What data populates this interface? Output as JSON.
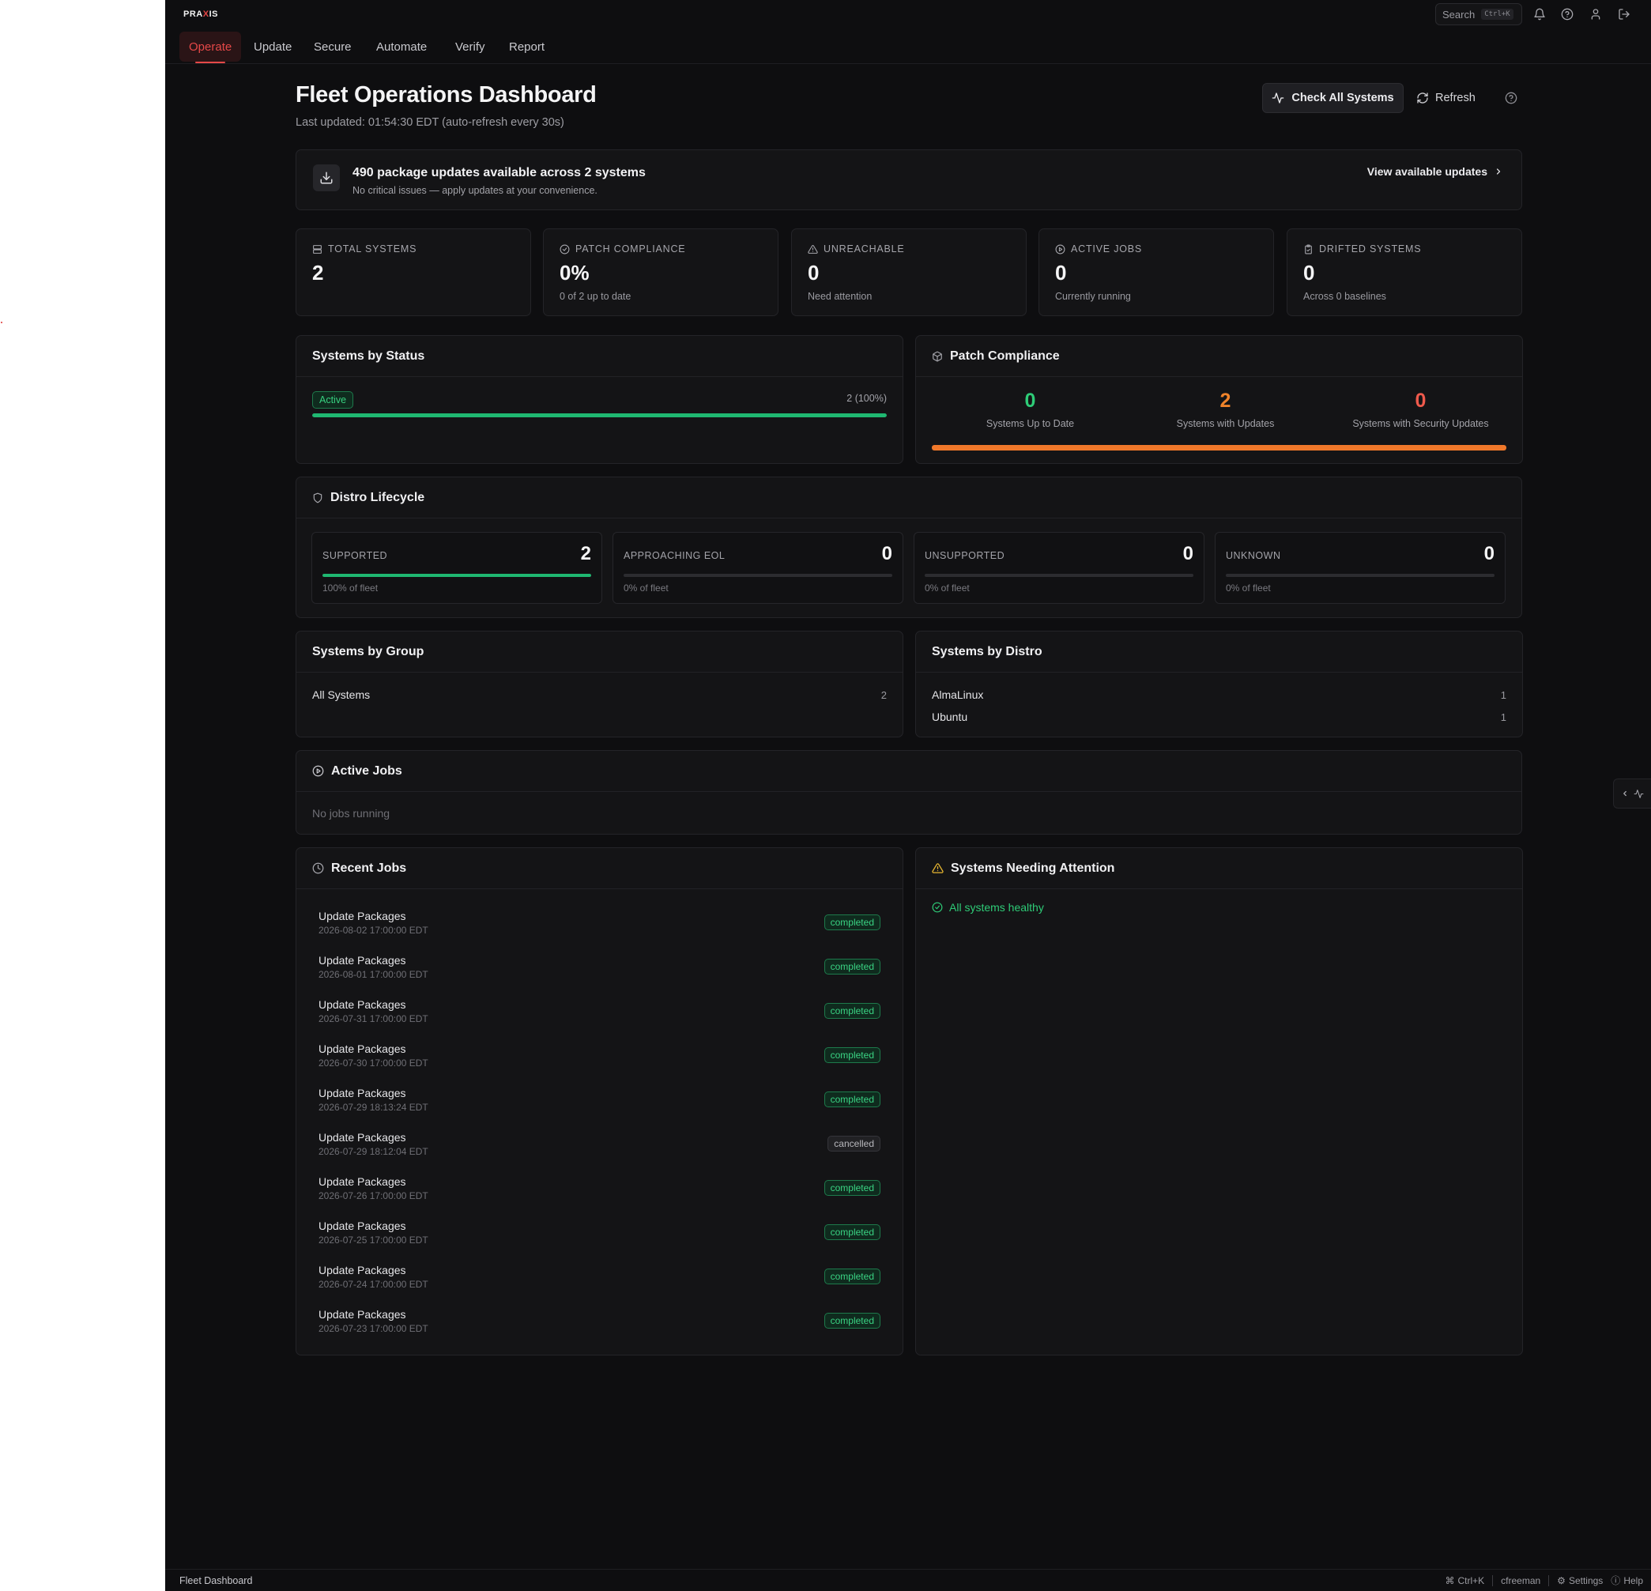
{
  "app": {
    "logo": "PRAXIS"
  },
  "topbar": {
    "search_label": "Search",
    "search_shortcut": "Ctrl+K"
  },
  "nav": {
    "tabs": [
      {
        "label": "Operate",
        "active": true
      },
      {
        "label": "Update"
      },
      {
        "label": "Secure"
      },
      {
        "label": "Automate"
      },
      {
        "label": "Verify"
      },
      {
        "label": "Report"
      }
    ]
  },
  "header": {
    "title": "Fleet Operations Dashboard",
    "subtitle": "Last updated: 01:54:30 EDT (auto-refresh every 30s)",
    "check_label": "Check All Systems",
    "refresh_label": "Refresh"
  },
  "banner": {
    "title": "490 package updates available across 2 systems",
    "subtitle": "No critical issues — apply updates at your convenience.",
    "link": "View available updates"
  },
  "stats": [
    {
      "label": "TOTAL SYSTEMS",
      "value": "2",
      "sub": "",
      "icon": "server-icon"
    },
    {
      "label": "PATCH COMPLIANCE",
      "value": "0%",
      "sub": "0 of 2 up to date",
      "icon": "check-circle-icon"
    },
    {
      "label": "UNREACHABLE",
      "value": "0",
      "sub": "Need attention",
      "icon": "warning-icon"
    },
    {
      "label": "ACTIVE JOBS",
      "value": "0",
      "sub": "Currently running",
      "icon": "play-circle-icon"
    },
    {
      "label": "DRIFTED SYSTEMS",
      "value": "0",
      "sub": "Across 0 baselines",
      "icon": "clipboard-icon"
    }
  ],
  "status_card": {
    "title": "Systems by Status",
    "badge": "Active",
    "count": "2 (100%)",
    "fill": 1.0,
    "color": "#1fb871"
  },
  "patch_card": {
    "title": "Patch Compliance",
    "cols": [
      {
        "value": "0",
        "label": "Systems Up to Date",
        "color": "#2ecc77"
      },
      {
        "value": "2",
        "label": "Systems with Updates",
        "color": "#f0832a"
      },
      {
        "value": "0",
        "label": "Systems with Security Updates",
        "color": "#ef5a4c"
      }
    ],
    "bar_color": "#f0782a",
    "fill": 1.0
  },
  "lifecycle": {
    "title": "Distro Lifecycle",
    "items": [
      {
        "label": "SUPPORTED",
        "value": "2",
        "pct": "100% of fleet",
        "fill": 1.0
      },
      {
        "label": "APPROACHING EOL",
        "value": "0",
        "pct": "0% of fleet",
        "fill": 0
      },
      {
        "label": "UNSUPPORTED",
        "value": "0",
        "pct": "0% of fleet",
        "fill": 0
      },
      {
        "label": "UNKNOWN",
        "value": "0",
        "pct": "0% of fleet",
        "fill": 0
      }
    ]
  },
  "groups": {
    "title": "Systems by Group",
    "items": [
      {
        "name": "All Systems",
        "count": "2"
      }
    ]
  },
  "distros": {
    "title": "Systems by Distro",
    "items": [
      {
        "name": "AlmaLinux",
        "count": "1"
      },
      {
        "name": "Ubuntu",
        "count": "1"
      }
    ]
  },
  "active_jobs": {
    "title": "Active Jobs",
    "empty": "No jobs running"
  },
  "recent_jobs": {
    "title": "Recent Jobs",
    "items": [
      {
        "name": "Update Packages",
        "date": "2026-08-02 17:00:00 EDT",
        "status": "completed"
      },
      {
        "name": "Update Packages",
        "date": "2026-08-01 17:00:00 EDT",
        "status": "completed"
      },
      {
        "name": "Update Packages",
        "date": "2026-07-31 17:00:00 EDT",
        "status": "completed"
      },
      {
        "name": "Update Packages",
        "date": "2026-07-30 17:00:00 EDT",
        "status": "completed"
      },
      {
        "name": "Update Packages",
        "date": "2026-07-29 18:13:24 EDT",
        "status": "completed"
      },
      {
        "name": "Update Packages",
        "date": "2026-07-29 18:12:04 EDT",
        "status": "cancelled"
      },
      {
        "name": "Update Packages",
        "date": "2026-07-26 17:00:00 EDT",
        "status": "completed"
      },
      {
        "name": "Update Packages",
        "date": "2026-07-25 17:00:00 EDT",
        "status": "completed"
      },
      {
        "name": "Update Packages",
        "date": "2026-07-24 17:00:00 EDT",
        "status": "completed"
      },
      {
        "name": "Update Packages",
        "date": "2026-07-23 17:00:00 EDT",
        "status": "completed"
      }
    ]
  },
  "attention": {
    "title": "Systems Needing Attention",
    "healthy": "All systems healthy"
  },
  "statusbar": {
    "page": "Fleet Dashboard",
    "shortcut": "Ctrl+K",
    "user": "cfreeman",
    "settings": "Settings",
    "help": "Help"
  },
  "colors": {
    "accent": "#e54848",
    "success": "#2ecc77",
    "warning": "#f0832a",
    "danger": "#ef5a4c"
  }
}
